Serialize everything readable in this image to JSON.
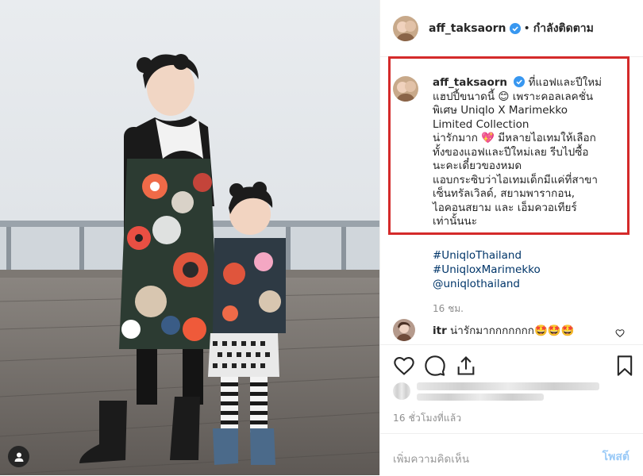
{
  "header": {
    "username": "aff_taksaorn",
    "separator": "•",
    "follow_status": "กำลังติดตาม"
  },
  "caption": {
    "username": "aff_taksaorn",
    "lines": [
      "ที่แอฟและปีใหม่",
      "แฮปปี้ขนาดนี้ 😊 เพราะคอลเลคชั่น",
      "พิเศษ Uniqlo X Marimekko",
      "Limited Collection",
      "น่ารักมาก 💖 มีหลายไอเทมให้เลือก",
      "ทั้งของแอฟและปีใหม่เลย รีบไปซื้อ",
      "นะคะเดี๋ยวของหมด",
      "แอบกระซิบว่าไอเทมเด็กมีแค่ที่สาขา",
      "เซ็นทรัลเวิลด์, สยามพารากอน,",
      "ไอคอนสยาม และ เอ็มควอเทียร์",
      "เท่านั้นนะ"
    ]
  },
  "hashtags": [
    "#UniqloThailand",
    "#UniqloxMarimekko",
    "@uniqlothailand"
  ],
  "caption_time": "16 ชม.",
  "comments": [
    {
      "username": "itr",
      "text": "น่ารักมากกกกกกก🤩🤩🤩"
    }
  ],
  "actions": {
    "like_icon": "heart-outline-icon",
    "comment_icon": "comment-bubble-icon",
    "share_icon": "share-icon",
    "save_icon": "bookmark-icon"
  },
  "posted_time": "16 ชั่วโมงที่แล้ว",
  "comment_input": {
    "placeholder": "เพิ่มความคิดเห็น",
    "post_label": "โพสต์"
  },
  "colors": {
    "highlight_border": "#d42a2a",
    "link": "#003569",
    "accent": "#3897f0",
    "verified": "#3897f0"
  }
}
